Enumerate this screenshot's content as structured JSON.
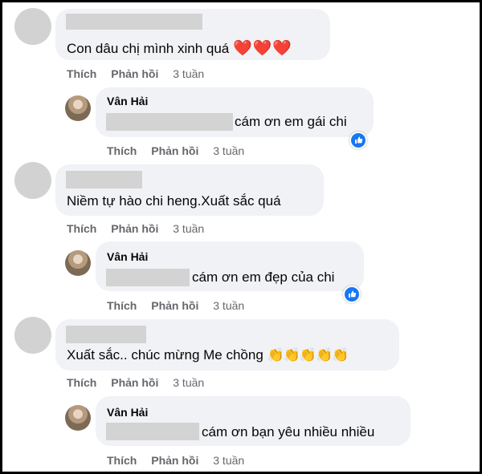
{
  "actions": {
    "like": "Thích",
    "reply": "Phản hồi"
  },
  "threads": [
    {
      "comment": {
        "text": "Con dâu chị mình xinh quá",
        "emoji": "❤️❤️❤️",
        "time": "3 tuần"
      },
      "reply": {
        "author": "Vân Hải",
        "text": "cám ơn em gái chi",
        "time": "3 tuần",
        "has_like_reaction": true
      }
    },
    {
      "comment": {
        "text": "Niềm tự hào chi heng.Xuất sắc quá",
        "emoji": "",
        "time": "3 tuần"
      },
      "reply": {
        "author": "Vân Hải",
        "text": "cám ơn em đẹp của chi",
        "time": "3 tuần",
        "has_like_reaction": true
      }
    },
    {
      "comment": {
        "text": "Xuất sắc.. chúc mừng Me chồng",
        "emoji": "👏👏👏👏👏",
        "time": "3 tuần"
      },
      "reply": {
        "author": "Vân Hải",
        "text": "cám ơn bạn yêu nhiều nhiều",
        "time": "3 tuần",
        "has_like_reaction": false
      }
    }
  ],
  "colors": {
    "bubble": "#f0f2f5",
    "like_blue": "#1877f2",
    "meta_gray": "#65676b",
    "heart_red": "#e41e3f"
  }
}
